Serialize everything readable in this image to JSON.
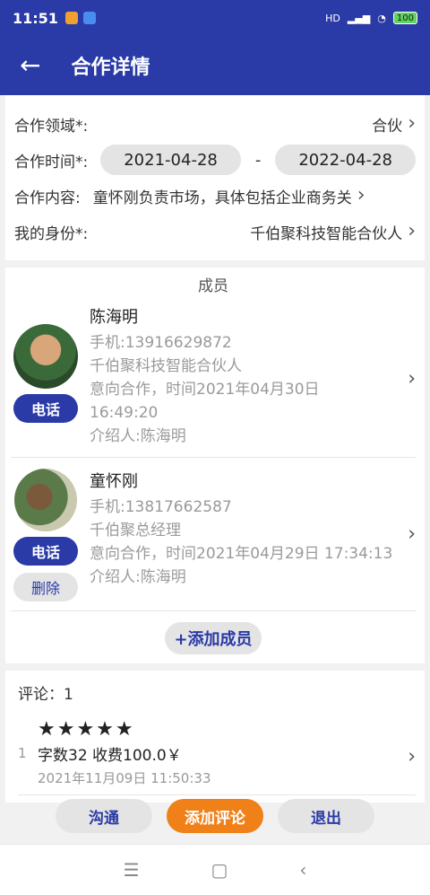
{
  "status": {
    "time": "11:51",
    "signal": "HD",
    "battery": "100"
  },
  "appbar": {
    "back_icon": "←",
    "title": "合作详情"
  },
  "info": {
    "field_label": "合作领域*:",
    "field_value": "合伙",
    "time_label": "合作时间*:",
    "start_date": "2021-04-28",
    "dash": "-",
    "end_date": "2022-04-28",
    "content_label": "合作内容:",
    "content_value": "童怀刚负责市场，具体包括企业商务关",
    "identity_label": "我的身份*:",
    "identity_value": "千伯聚科技智能合伙人"
  },
  "members": {
    "title": "成员",
    "list": [
      {
        "name": "陈海明",
        "phone": "手机:13916629872",
        "role": "千伯聚科技智能合伙人",
        "intent1": "意向合作，时间2021年04月30日",
        "intent2": "16:49:20",
        "referrer": "介绍人:陈海明",
        "call_label": "电话"
      },
      {
        "name": "童怀刚",
        "phone": "手机:13817662587",
        "role": "千伯聚总经理",
        "intent1": "意向合作，时间2021年04月29日 17:34:13",
        "referrer": "介绍人:陈海明",
        "call_label": "电话",
        "delete_label": "删除"
      }
    ],
    "add_label": "+添加成员"
  },
  "comments": {
    "title": "评论：1",
    "items": [
      {
        "index": "1",
        "stars": "★★★★★",
        "rating": 5,
        "summary": "字数32 收费100.0￥",
        "date": "2021年11月09日 11:50:33"
      }
    ]
  },
  "actions": {
    "communicate": "沟通",
    "add_comment": "添加评论",
    "exit": "退出"
  },
  "navbar": {
    "menu": "☰",
    "home": "▢",
    "back": "‹"
  },
  "colors": {
    "primary": "#2a3aa6",
    "accent": "#f08018"
  }
}
